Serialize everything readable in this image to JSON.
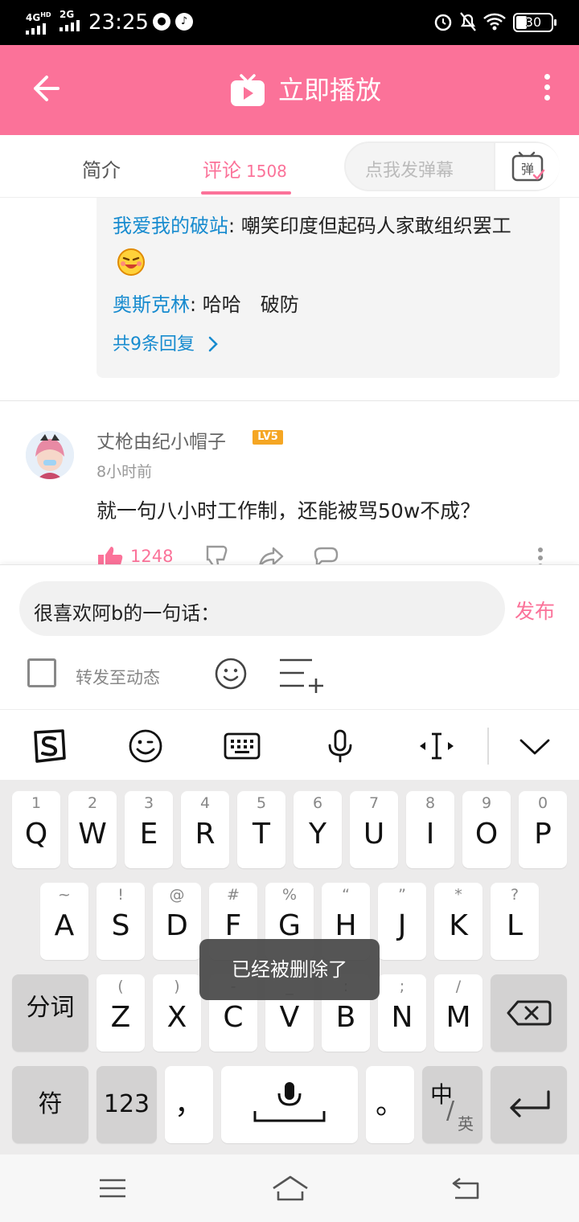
{
  "status_bar": {
    "network_1": "4G",
    "network_1_sup": "HD",
    "network_2": "2G",
    "time": "23:25",
    "battery": "30"
  },
  "title_bar": {
    "title": "立即播放"
  },
  "tabs": {
    "intro": "简介",
    "comments": "评论",
    "comments_count": "1508",
    "danmu_placeholder": "点我发弹幕",
    "danmu_icon_text": "弹"
  },
  "replies": {
    "items": [
      {
        "user": "我爱我的破站",
        "text": "嘲笑印度但起码人家敢组织罢工"
      },
      {
        "user": "奥斯克林",
        "text": "哈哈　破防"
      }
    ],
    "more": "共9条回复"
  },
  "comment": {
    "username": "丈枪由纪小帽子",
    "level": "LV5",
    "time": "8小时前",
    "text": "就一句八小时工作制，还能被骂50w不成？",
    "likes": "1248"
  },
  "composer": {
    "input_value": "很喜欢阿b的一句话：",
    "publish": "发布",
    "forward_label": "转发至动态"
  },
  "keyboard": {
    "row1": [
      {
        "hint": "1",
        "key": "Q"
      },
      {
        "hint": "2",
        "key": "W"
      },
      {
        "hint": "3",
        "key": "E"
      },
      {
        "hint": "4",
        "key": "R"
      },
      {
        "hint": "5",
        "key": "T"
      },
      {
        "hint": "6",
        "key": "Y"
      },
      {
        "hint": "7",
        "key": "U"
      },
      {
        "hint": "8",
        "key": "I"
      },
      {
        "hint": "9",
        "key": "O"
      },
      {
        "hint": "0",
        "key": "P"
      }
    ],
    "row2": [
      {
        "hint": "~",
        "key": "A"
      },
      {
        "hint": "!",
        "key": "S"
      },
      {
        "hint": "@",
        "key": "D"
      },
      {
        "hint": "#",
        "key": "F"
      },
      {
        "hint": "%",
        "key": "G"
      },
      {
        "hint": "“",
        "key": "H"
      },
      {
        "hint": "”",
        "key": "J"
      },
      {
        "hint": "*",
        "key": "K"
      },
      {
        "hint": "?",
        "key": "L"
      }
    ],
    "row3": [
      {
        "hint": "(",
        "key": "Z"
      },
      {
        "hint": ")",
        "key": "X"
      },
      {
        "hint": "-",
        "key": "C"
      },
      {
        "hint": "_",
        "key": "V"
      },
      {
        "hint": ":",
        "key": "B"
      },
      {
        "hint": ";",
        "key": "N"
      },
      {
        "hint": "/",
        "key": "M"
      }
    ],
    "segment": "分词",
    "symbol": "符",
    "numbers": "123",
    "comma": "，",
    "period": "。",
    "lang_main": "中",
    "lang_alt": "英"
  },
  "toast": "已经被删除了"
}
